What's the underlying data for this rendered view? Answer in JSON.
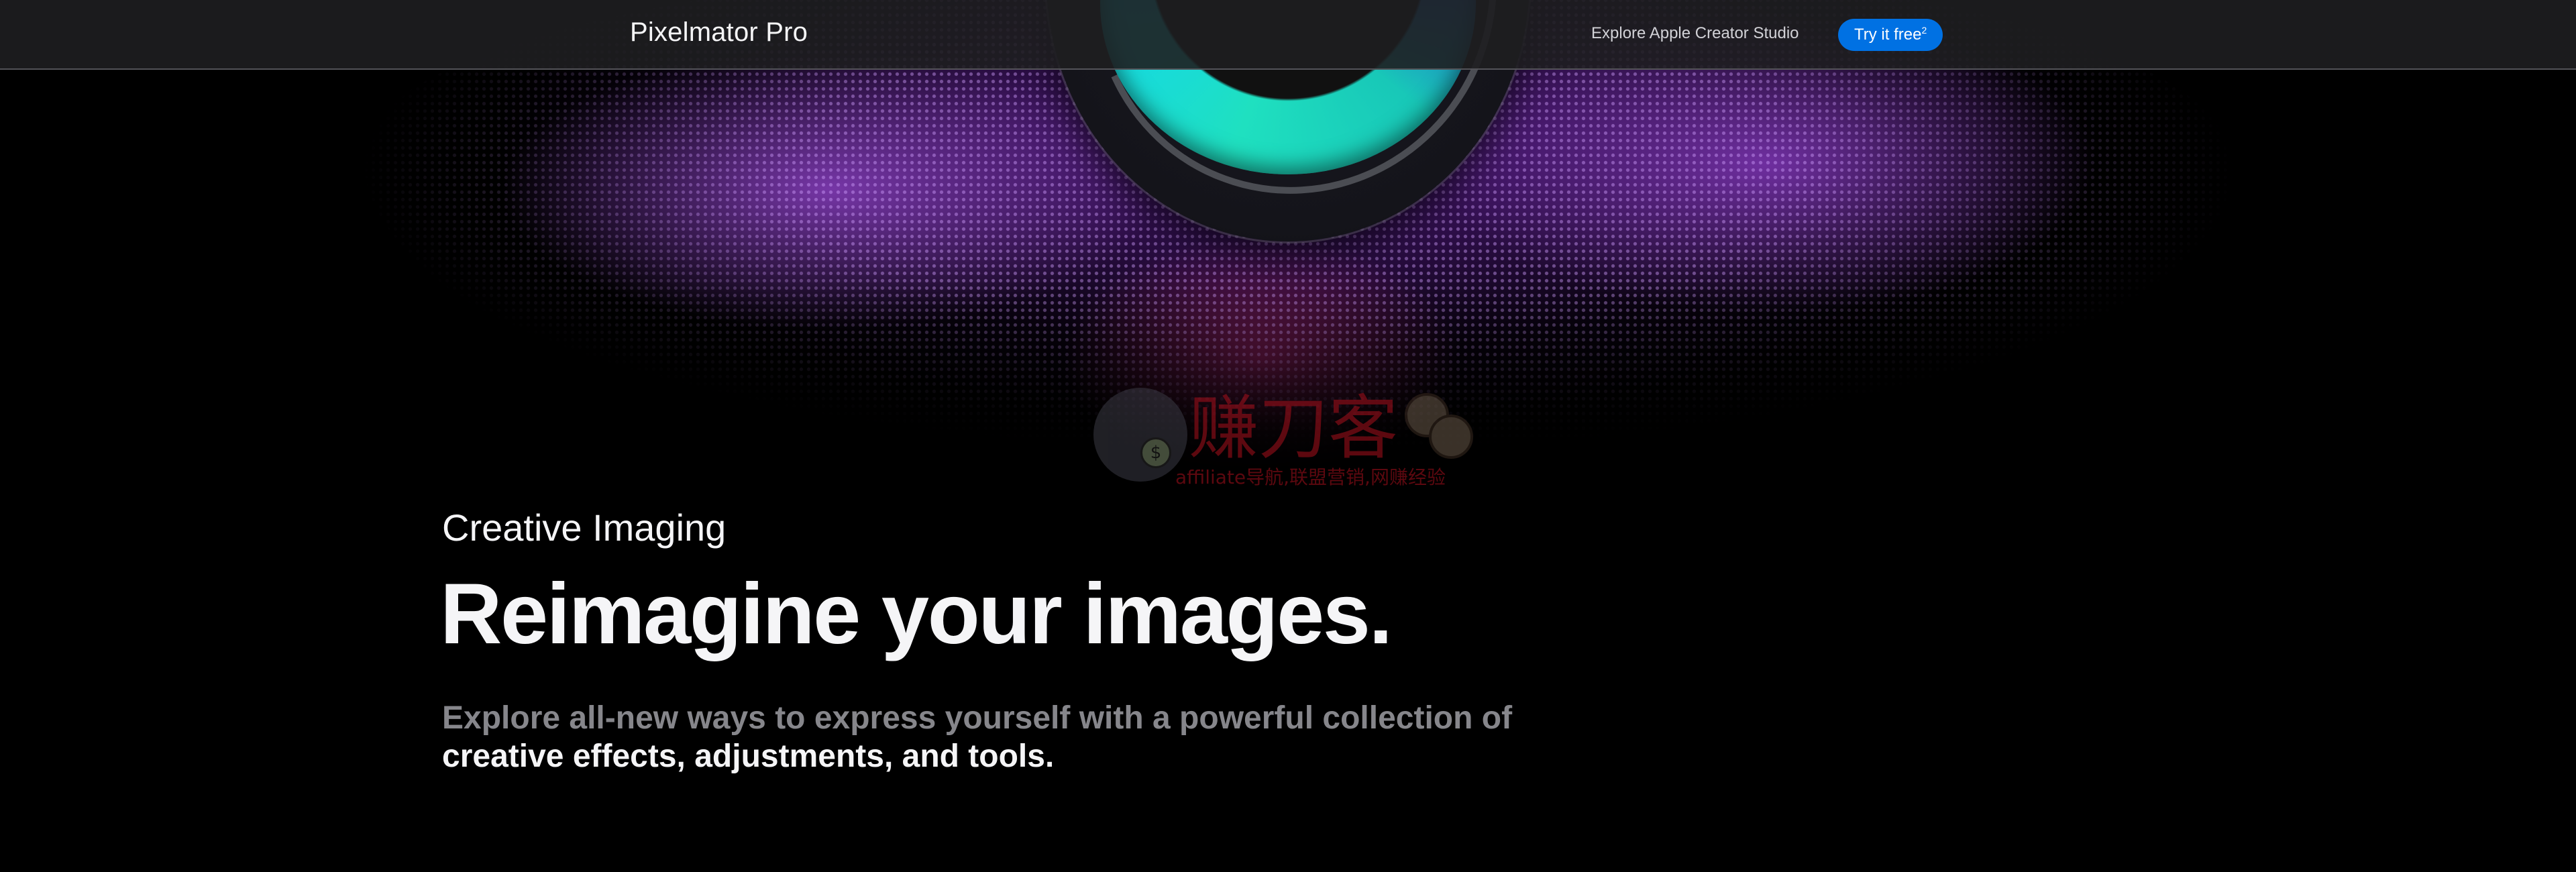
{
  "nav": {
    "title": "Pixelmator Pro",
    "link": "Explore Apple Creator Studio",
    "cta_label": "Try it free",
    "cta_footnote": "2",
    "cta_color": "#0071e3"
  },
  "hero": {
    "eyebrow": "Creative Imaging",
    "headline": "Reimagine your images.",
    "body_muted": "Explore all-new ways to express yourself with a powerful collection of",
    "body_highlight": "creative effects, adjustments, and tools.",
    "artwork_icon": "camera-lens-artwork"
  },
  "watermark": {
    "text_cn": "赚刀客",
    "text_en": "affiliate导航,联盟营销,网赚经验",
    "badge_symbol": "$",
    "color": "#a8101c"
  },
  "colors": {
    "background": "#000000",
    "text_primary": "#f5f5f7",
    "text_muted": "#86868b",
    "nav_link": "#d2d2d7"
  }
}
